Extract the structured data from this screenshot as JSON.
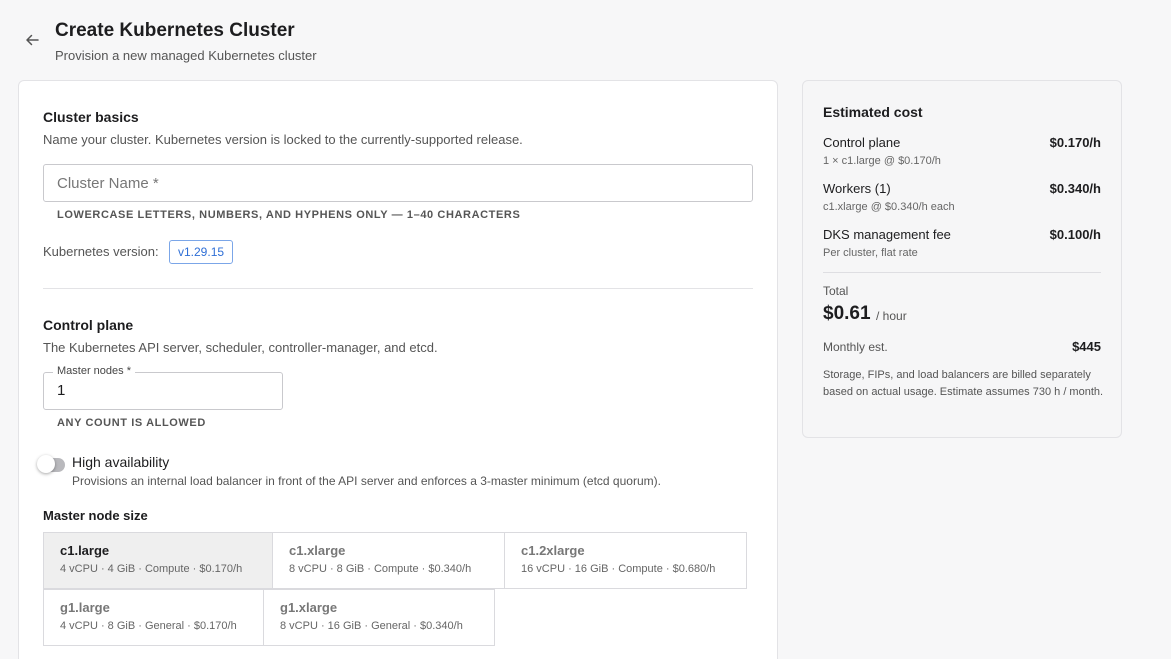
{
  "header": {
    "title": "Create Kubernetes Cluster",
    "subtitle": "Provision a new managed Kubernetes cluster"
  },
  "cluster_basics": {
    "title": "Cluster basics",
    "description": "Name your cluster. Kubernetes version is locked to the currently-supported release.",
    "name_placeholder": "Cluster Name *",
    "name_value": "",
    "name_hint": "Lowercase letters, numbers, and hyphens only — 1–40 characters",
    "version_label": "Kubernetes version:",
    "version_value": "v1.29.15"
  },
  "control_plane": {
    "title": "Control plane",
    "description": "The Kubernetes API server, scheduler, controller-manager, and etcd.",
    "master_label": "Master nodes *",
    "master_value": "1",
    "master_hint": "Any count is allowed",
    "ha_title": "High availability",
    "ha_desc": "Provisions an internal load balancer in front of the API server and enforces a 3-master minimum (etcd quorum).",
    "ha_enabled": false,
    "size_title": "Master node size",
    "sizes": [
      {
        "name": "c1.large",
        "spec": "4 vCPU · 4 GiB · Compute · $0.170/h",
        "selected": true
      },
      {
        "name": "c1.xlarge",
        "spec": "8 vCPU · 8 GiB · Compute · $0.340/h",
        "selected": false
      },
      {
        "name": "c1.2xlarge",
        "spec": "16 vCPU · 16 GiB · Compute · $0.680/h",
        "selected": false
      },
      {
        "name": "g1.large",
        "spec": "4 vCPU · 8 GiB · General · $0.170/h",
        "selected": false
      },
      {
        "name": "g1.xlarge",
        "spec": "8 vCPU · 16 GiB · General · $0.340/h",
        "selected": false
      }
    ]
  },
  "cost": {
    "title": "Estimated cost",
    "lines": [
      {
        "label": "Control plane",
        "value": "$0.170/h",
        "sub": "1 × c1.large @ $0.170/h"
      },
      {
        "label": "Workers (1)",
        "value": "$0.340/h",
        "sub": "c1.xlarge @ $0.340/h each"
      },
      {
        "label": "DKS management fee",
        "value": "$0.100/h",
        "sub": "Per cluster, flat rate"
      }
    ],
    "total_label": "Total",
    "total_value": "$0.61",
    "total_unit": "/ hour",
    "monthly_label": "Monthly est.",
    "monthly_value": "$445",
    "note": "Storage, FIPs, and load balancers are billed separately based on actual usage. Estimate assumes 730 h / month."
  },
  "icons": {
    "back": "arrow-left-icon"
  }
}
